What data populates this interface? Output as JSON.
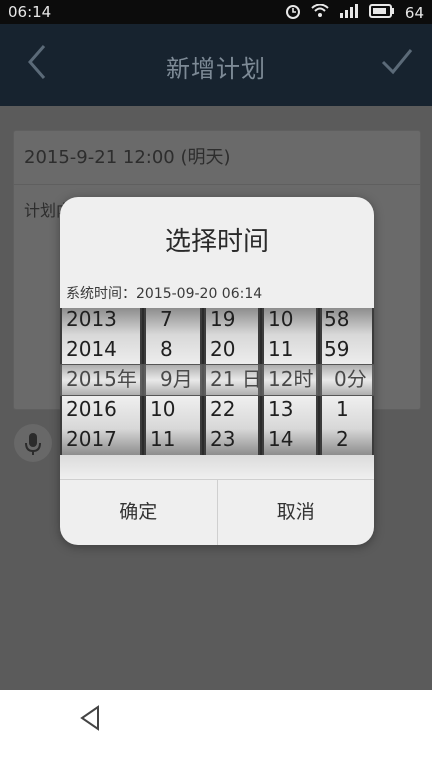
{
  "status_bar": {
    "time": "06:14",
    "battery": "64"
  },
  "header": {
    "title": "新增计划"
  },
  "form": {
    "date_value": "2015-9-21 12:00  (明天)",
    "plan_label": "计划内容"
  },
  "dialog": {
    "title": "选择时间",
    "system_time": "系统时间：2015-09-20 06:14",
    "wheels": {
      "year": [
        "2013",
        "2014",
        "2015年",
        "2016",
        "2017"
      ],
      "month": [
        "7",
        "8",
        "9月",
        "10",
        "11"
      ],
      "day": [
        "19",
        "20",
        "21 日",
        "22",
        "23"
      ],
      "hour": [
        "10",
        "11",
        "12时",
        "13",
        "14"
      ],
      "minute": [
        "58",
        "59",
        "0分",
        "1",
        "2"
      ]
    },
    "confirm_label": "确定",
    "cancel_label": "取消"
  }
}
